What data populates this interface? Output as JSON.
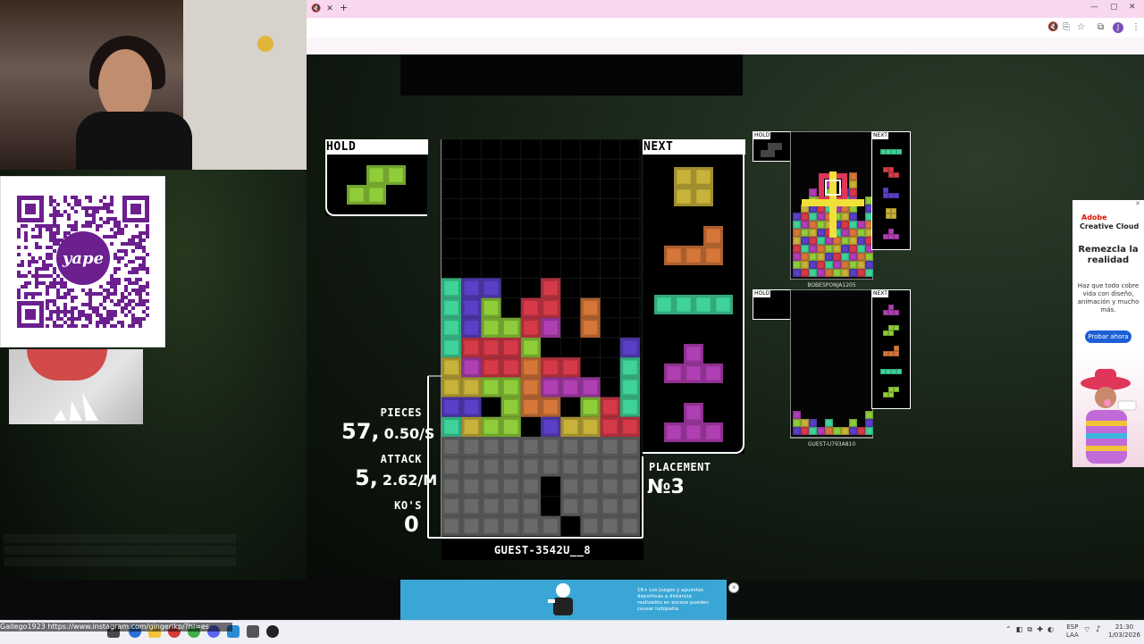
{
  "browser": {
    "tab_close": "✕",
    "new_tab": "+",
    "window_controls": [
      "—",
      "▢",
      "✕"
    ],
    "profile_initial": "J"
  },
  "game": {
    "hold_label": "HOLD",
    "next_label": "NEXT",
    "pieces_label": "PIECES",
    "pieces_value": "57,",
    "pieces_rate": "0.50/S",
    "attack_label": "ATTACK",
    "attack_value": "5,",
    "attack_rate": "2.62/M",
    "kos_label": "KO'S",
    "kos_value": "0",
    "placement_label": "PLACEMENT",
    "placement_value": "№3",
    "player_name": "GUEST-3542U__8",
    "colors": {
      "I": "#3fd39a",
      "O": "#c9b23a",
      "T": "#b03fb3",
      "S": "#8fcd3a",
      "Z": "#d63a48",
      "J": "#5b3fc7",
      "L": "#d6773a",
      "G": "#6a6a6a"
    },
    "hold_piece": "S",
    "next_queue": [
      "O",
      "L",
      "I",
      "T",
      "T"
    ],
    "board": [
      "..........",
      "..........",
      "..........",
      "..........",
      "..........",
      "..........",
      "..........",
      "IJJ..Z....",
      "IJS.ZZ.L..",
      "IJSSZT.L..",
      "IZZZS....J",
      "OTZZLZZ..I",
      "OOSSLTTT.I",
      "JJ.SLL.SZI",
      "IOSS.JOOZZ",
      "GGGGGGGGGG",
      "GGGGGGGGGG",
      "GGGGG.GGGG",
      "GGGGG.GGGG",
      "GGGGGG.GGG"
    ]
  },
  "opponents": [
    {
      "name": "BOBESPONJA1205",
      "hold_label": "HOLD",
      "next_label": "NEXT",
      "next_queue": [
        "I",
        "Z",
        "J",
        "O",
        "T"
      ]
    },
    {
      "name": "GUEST-U793A810",
      "hold_label": "HOLD",
      "next_label": "NEXT",
      "next_queue": [
        "T",
        "S",
        "L",
        "I",
        "S"
      ]
    }
  ],
  "ads": {
    "right": {
      "brand": "Adobe",
      "brand2": "Creative Cloud",
      "headline": "Remezcla la realidad",
      "body": "Haz que todo cobre vida con diseño, animación y mucho más.",
      "cta": "Probar ahora",
      "close": "✕"
    },
    "bottom": {
      "text": "18+ Los juegos y apuestas deportivas a distancia realizados en exceso pueden causar ludopatía.",
      "close": "✕"
    }
  },
  "stream": {
    "link_text": "Gallego1923  https://www.instagram.com/gingerlkp/?hl=es",
    "qr_brand": "yape"
  },
  "taskbar": {
    "lang_top": "ESP",
    "lang_bottom": "LAA",
    "time": "21:30",
    "date": "1/03/2026"
  }
}
